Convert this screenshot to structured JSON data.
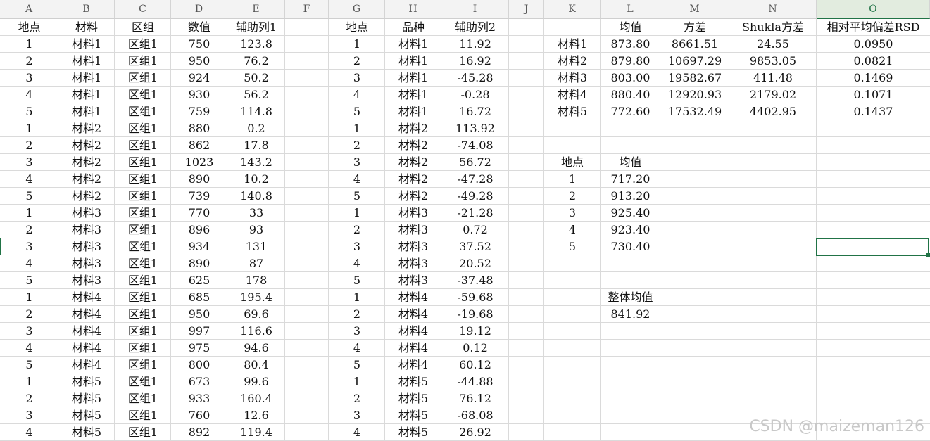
{
  "columns": [
    "A",
    "B",
    "C",
    "D",
    "E",
    "F",
    "G",
    "H",
    "I",
    "J",
    "K",
    "L",
    "M",
    "N",
    "O"
  ],
  "selected_column": "O",
  "left_table": {
    "headers": [
      "地点",
      "材料",
      "区组",
      "数值",
      "辅助列1"
    ],
    "rows": [
      [
        "1",
        "材料1",
        "区组1",
        "750",
        "123.8"
      ],
      [
        "2",
        "材料1",
        "区组1",
        "950",
        "76.2"
      ],
      [
        "3",
        "材料1",
        "区组1",
        "924",
        "50.2"
      ],
      [
        "4",
        "材料1",
        "区组1",
        "930",
        "56.2"
      ],
      [
        "5",
        "材料1",
        "区组1",
        "759",
        "114.8"
      ],
      [
        "1",
        "材料2",
        "区组1",
        "880",
        "0.2"
      ],
      [
        "2",
        "材料2",
        "区组1",
        "862",
        "17.8"
      ],
      [
        "3",
        "材料2",
        "区组1",
        "1023",
        "143.2"
      ],
      [
        "4",
        "材料2",
        "区组1",
        "890",
        "10.2"
      ],
      [
        "5",
        "材料2",
        "区组1",
        "739",
        "140.8"
      ],
      [
        "1",
        "材料3",
        "区组1",
        "770",
        "33"
      ],
      [
        "2",
        "材料3",
        "区组1",
        "896",
        "93"
      ],
      [
        "3",
        "材料3",
        "区组1",
        "934",
        "131"
      ],
      [
        "4",
        "材料3",
        "区组1",
        "890",
        "87"
      ],
      [
        "5",
        "材料3",
        "区组1",
        "625",
        "178"
      ],
      [
        "1",
        "材料4",
        "区组1",
        "685",
        "195.4"
      ],
      [
        "2",
        "材料4",
        "区组1",
        "950",
        "69.6"
      ],
      [
        "3",
        "材料4",
        "区组1",
        "997",
        "116.6"
      ],
      [
        "4",
        "材料4",
        "区组1",
        "975",
        "94.6"
      ],
      [
        "5",
        "材料4",
        "区组1",
        "800",
        "80.4"
      ],
      [
        "1",
        "材料5",
        "区组1",
        "673",
        "99.6"
      ],
      [
        "2",
        "材料5",
        "区组1",
        "933",
        "160.4"
      ],
      [
        "3",
        "材料5",
        "区组1",
        "760",
        "12.6"
      ],
      [
        "4",
        "材料5",
        "区组1",
        "892",
        "119.4"
      ]
    ]
  },
  "middle_table": {
    "headers": [
      "地点",
      "品种",
      "辅助列2"
    ],
    "rows": [
      [
        "1",
        "材料1",
        "11.92"
      ],
      [
        "2",
        "材料1",
        "16.92"
      ],
      [
        "3",
        "材料1",
        "-45.28"
      ],
      [
        "4",
        "材料1",
        "-0.28"
      ],
      [
        "5",
        "材料1",
        "16.72"
      ],
      [
        "1",
        "材料2",
        "113.92"
      ],
      [
        "2",
        "材料2",
        "-74.08"
      ],
      [
        "3",
        "材料2",
        "56.72"
      ],
      [
        "4",
        "材料2",
        "-47.28"
      ],
      [
        "5",
        "材料2",
        "-49.28"
      ],
      [
        "1",
        "材料3",
        "-21.28"
      ],
      [
        "2",
        "材料3",
        "0.72"
      ],
      [
        "3",
        "材料3",
        "37.52"
      ],
      [
        "4",
        "材料3",
        "20.52"
      ],
      [
        "5",
        "材料3",
        "-37.48"
      ],
      [
        "1",
        "材料4",
        "-59.68"
      ],
      [
        "2",
        "材料4",
        "-19.68"
      ],
      [
        "3",
        "材料4",
        "19.12"
      ],
      [
        "4",
        "材料4",
        "0.12"
      ],
      [
        "5",
        "材料4",
        "60.12"
      ],
      [
        "1",
        "材料5",
        "-44.88"
      ],
      [
        "2",
        "材料5",
        "76.12"
      ],
      [
        "3",
        "材料5",
        "-68.08"
      ],
      [
        "4",
        "材料5",
        "26.92"
      ]
    ]
  },
  "stats_table": {
    "headers": [
      "",
      "均值",
      "方差",
      "Shukla方差",
      "相对平均偏差RSD"
    ],
    "rows": [
      [
        "材料1",
        "873.80",
        "8661.51",
        "24.55",
        "0.0950"
      ],
      [
        "材料2",
        "879.80",
        "10697.29",
        "9853.05",
        "0.0821"
      ],
      [
        "材料3",
        "803.00",
        "19582.67",
        "411.48",
        "0.1469"
      ],
      [
        "材料4",
        "880.40",
        "12920.93",
        "2179.02",
        "0.1071"
      ],
      [
        "材料5",
        "772.60",
        "17532.49",
        "4402.95",
        "0.1437"
      ]
    ]
  },
  "location_table": {
    "headers": [
      "地点",
      "均值"
    ],
    "rows": [
      [
        "1",
        "717.20"
      ],
      [
        "2",
        "913.20"
      ],
      [
        "3",
        "925.40"
      ],
      [
        "4",
        "923.40"
      ],
      [
        "5",
        "730.40"
      ]
    ]
  },
  "overall": {
    "label": "整体均值",
    "value": "841.92"
  },
  "watermark": "CSDN @maizeman126",
  "colors": {
    "accent": "#217346",
    "grid": "#dadada",
    "header_bg": "#f3f3f3"
  }
}
